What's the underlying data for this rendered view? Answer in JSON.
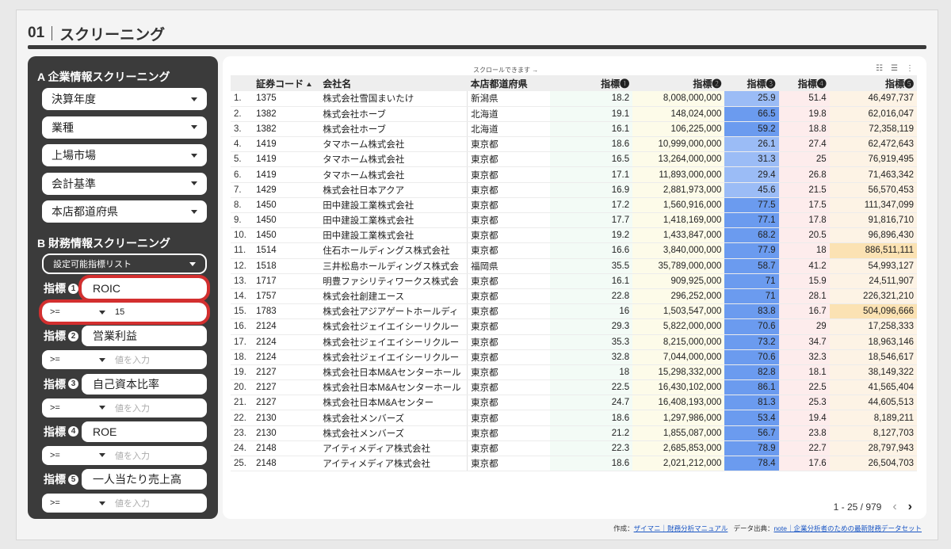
{
  "header": {
    "num": "01",
    "title": "スクリーニング"
  },
  "sidebar": {
    "section_a": "A 企業情報スクリーニング",
    "filters": [
      "決算年度",
      "業種",
      "上場市場",
      "会計基準",
      "本店都道府県"
    ],
    "section_b": "B 財務情報スクリーニング",
    "indicator_list": "設定可能指標リスト",
    "indicators": [
      {
        "label": "指標",
        "badge": "1",
        "name": "ROIC",
        "op": ">=",
        "value": "15",
        "placeholder": "値を入力"
      },
      {
        "label": "指標",
        "badge": "2",
        "name": "営業利益",
        "op": ">=",
        "value": "",
        "placeholder": "値を入力"
      },
      {
        "label": "指標",
        "badge": "3",
        "name": "自己資本比率",
        "op": ">=",
        "value": "",
        "placeholder": "値を入力"
      },
      {
        "label": "指標",
        "badge": "4",
        "name": "ROE",
        "op": ">=",
        "value": "",
        "placeholder": "値を入力"
      },
      {
        "label": "指標",
        "badge": "5",
        "name": "一人当たり売上高",
        "op": ">=",
        "value": "",
        "placeholder": "値を入力"
      }
    ]
  },
  "table": {
    "scroll_hint": "スクロールできます →",
    "columns": [
      "証券コード",
      "会社名",
      "本店都道府県",
      "指標❶",
      "指標❷",
      "指標❸",
      "指標❹",
      "指標❺"
    ],
    "rows": [
      [
        "1.",
        "1375",
        "株式会社雪国まいたけ",
        "新潟県",
        "18.2",
        "8,008,000,000",
        "25.9",
        "51.4",
        "46,497,737"
      ],
      [
        "2.",
        "1382",
        "株式会社ホーブ",
        "北海道",
        "19.1",
        "148,024,000",
        "66.5",
        "19.8",
        "62,016,047"
      ],
      [
        "3.",
        "1382",
        "株式会社ホーブ",
        "北海道",
        "16.1",
        "106,225,000",
        "59.2",
        "18.8",
        "72,358,119"
      ],
      [
        "4.",
        "1419",
        "タマホーム株式会社",
        "東京都",
        "18.6",
        "10,999,000,000",
        "26.1",
        "27.4",
        "62,472,643"
      ],
      [
        "5.",
        "1419",
        "タマホーム株式会社",
        "東京都",
        "16.5",
        "13,264,000,000",
        "31.3",
        "25",
        "76,919,495"
      ],
      [
        "6.",
        "1419",
        "タマホーム株式会社",
        "東京都",
        "17.1",
        "11,893,000,000",
        "29.4",
        "26.8",
        "71,463,342"
      ],
      [
        "7.",
        "1429",
        "株式会社日本アクア",
        "東京都",
        "16.9",
        "2,881,973,000",
        "45.6",
        "21.5",
        "56,570,453"
      ],
      [
        "8.",
        "1450",
        "田中建設工業株式会社",
        "東京都",
        "17.2",
        "1,560,916,000",
        "77.5",
        "17.5",
        "111,347,099"
      ],
      [
        "9.",
        "1450",
        "田中建設工業株式会社",
        "東京都",
        "17.7",
        "1,418,169,000",
        "77.1",
        "17.8",
        "91,816,710"
      ],
      [
        "10.",
        "1450",
        "田中建設工業株式会社",
        "東京都",
        "19.2",
        "1,433,847,000",
        "68.2",
        "20.5",
        "96,896,430"
      ],
      [
        "11.",
        "1514",
        "住石ホールディングス株式会社",
        "東京都",
        "16.6",
        "3,840,000,000",
        "77.9",
        "18",
        "886,511,111"
      ],
      [
        "12.",
        "1518",
        "三井松島ホールディングス株式会",
        "福岡県",
        "35.5",
        "35,789,000,000",
        "58.7",
        "41.2",
        "54,993,127"
      ],
      [
        "13.",
        "1717",
        "明豊ファシリティワークス株式会",
        "東京都",
        "16.1",
        "909,925,000",
        "71",
        "15.9",
        "24,511,907"
      ],
      [
        "14.",
        "1757",
        "株式会社創建エース",
        "東京都",
        "22.8",
        "296,252,000",
        "71",
        "28.1",
        "226,321,210"
      ],
      [
        "15.",
        "1783",
        "株式会社アジアゲートホールディ",
        "東京都",
        "16",
        "1,503,547,000",
        "83.8",
        "16.7",
        "504,096,666"
      ],
      [
        "16.",
        "2124",
        "株式会社ジェイエイシーリクルー",
        "東京都",
        "29.3",
        "5,822,000,000",
        "70.6",
        "29",
        "17,258,333"
      ],
      [
        "17.",
        "2124",
        "株式会社ジェイエイシーリクルー",
        "東京都",
        "35.3",
        "8,215,000,000",
        "73.2",
        "34.7",
        "18,963,146"
      ],
      [
        "18.",
        "2124",
        "株式会社ジェイエイシーリクルー",
        "東京都",
        "32.8",
        "7,044,000,000",
        "70.6",
        "32.3",
        "18,546,617"
      ],
      [
        "19.",
        "2127",
        "株式会社日本M&Aセンターホール",
        "東京都",
        "18",
        "15,298,332,000",
        "82.8",
        "18.1",
        "38,149,322"
      ],
      [
        "20.",
        "2127",
        "株式会社日本M&Aセンターホール",
        "東京都",
        "22.5",
        "16,430,102,000",
        "86.1",
        "22.5",
        "41,565,404"
      ],
      [
        "21.",
        "2127",
        "株式会社日本M&Aセンター",
        "東京都",
        "24.7",
        "16,408,193,000",
        "81.3",
        "25.3",
        "44,605,513"
      ],
      [
        "22.",
        "2130",
        "株式会社メンバーズ",
        "東京都",
        "18.6",
        "1,297,986,000",
        "53.4",
        "19.4",
        "8,189,211"
      ],
      [
        "23.",
        "2130",
        "株式会社メンバーズ",
        "東京都",
        "21.2",
        "1,855,087,000",
        "56.7",
        "23.8",
        "8,127,703"
      ],
      [
        "24.",
        "2148",
        "アイティメディア株式会社",
        "東京都",
        "22.3",
        "2,685,853,000",
        "78.9",
        "22.7",
        "28,797,943"
      ],
      [
        "25.",
        "2148",
        "アイティメディア株式会社",
        "東京都",
        "18.6",
        "2,021,212,000",
        "78.4",
        "17.6",
        "26,504,703"
      ]
    ],
    "pagination": "1 - 25 / 979",
    "prev": "‹",
    "next": "›"
  },
  "credit": {
    "made_by_label": "作成：",
    "made_by_link": "ザイマニ｜財務分析マニュアル",
    "source_label": "データ出典：",
    "source_link": "note｜企業分析者のための最新財務データセット"
  },
  "colors": {
    "m3_strong": "#6b9bef",
    "m3_light": "#9bbcf6",
    "m2_bg": "#fdfbe9",
    "m4_bg": "#fdecec",
    "m5_bg": "#fdf3e5",
    "m5_hl": "#fbe2b3",
    "highlight_border": "#d32f2f"
  }
}
